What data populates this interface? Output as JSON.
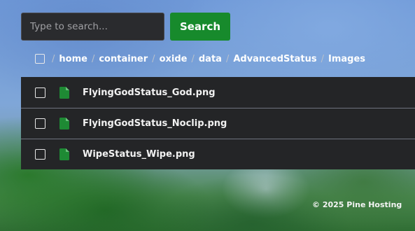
{
  "search": {
    "placeholder": "Type to search...",
    "value": "",
    "button_label": "Search"
  },
  "breadcrumb": {
    "separator": "/",
    "items": [
      "home",
      "container",
      "oxide",
      "data",
      "AdvancedStatus",
      "Images"
    ]
  },
  "files": [
    {
      "name": "FlyingGodStatus_God.png",
      "icon": "file-icon"
    },
    {
      "name": "FlyingGodStatus_Noclip.png",
      "icon": "file-icon"
    },
    {
      "name": "WipeStatus_Wipe.png",
      "icon": "file-icon"
    }
  ],
  "footer": {
    "text": "© 2025 Pine Hosting"
  },
  "colors": {
    "accent": "#178a2c",
    "panel": "#242527",
    "file_icon": "#1e8a34"
  }
}
